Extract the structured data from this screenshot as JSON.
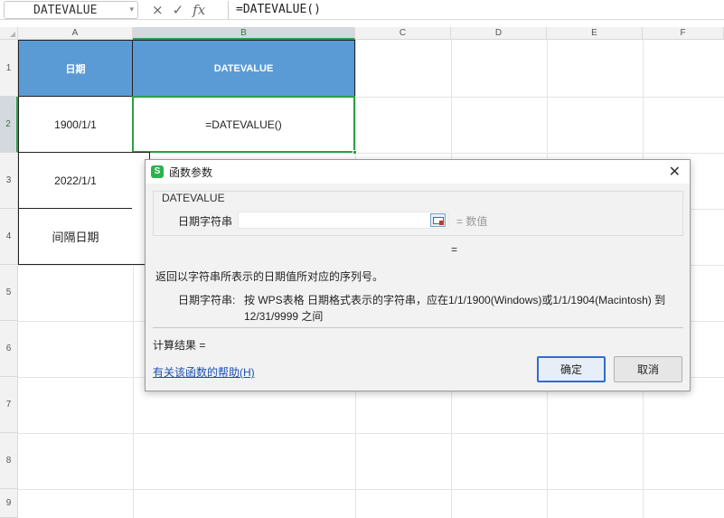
{
  "name_box": "DATEVALUE",
  "formula_bar": {
    "cancel_icon": "×",
    "enter_icon": "✓",
    "fx_label": "fx",
    "formula": "=DATEVALUE()"
  },
  "columns": [
    "A",
    "B",
    "C",
    "D",
    "E",
    "F"
  ],
  "rows": [
    "1",
    "2",
    "3",
    "4",
    "5",
    "6",
    "7",
    "8",
    "9"
  ],
  "cells": {
    "a1": "日期",
    "b1": "DATEVALUE",
    "a2": "1900/1/1",
    "b2": "=DATEVALUE()",
    "a3": "2022/1/1",
    "a4": "间隔日期"
  },
  "colors": {
    "header_fill": "#5b9bd5",
    "active_border": "#2e9e47",
    "link": "#1a4fb5"
  },
  "dialog": {
    "logo": "S",
    "title": "函数参数",
    "close_icon": "✕",
    "function_name": "DATEVALUE",
    "arg_label": "日期字符串",
    "arg_value": "",
    "arg_result": "= 数值",
    "equals": "=",
    "description": "返回以字符串所表示的日期值所对应的序列号。",
    "arg_desc_label": "日期字符串:",
    "arg_desc": "按 WPS表格 日期格式表示的字符串，应在1/1/1900(Windows)或1/1/1904(Macintosh) 到 12/31/9999 之间",
    "result": "计算结果 =",
    "help_link": "有关该函数的帮助(H)",
    "ok": "确定",
    "cancel": "取消"
  }
}
